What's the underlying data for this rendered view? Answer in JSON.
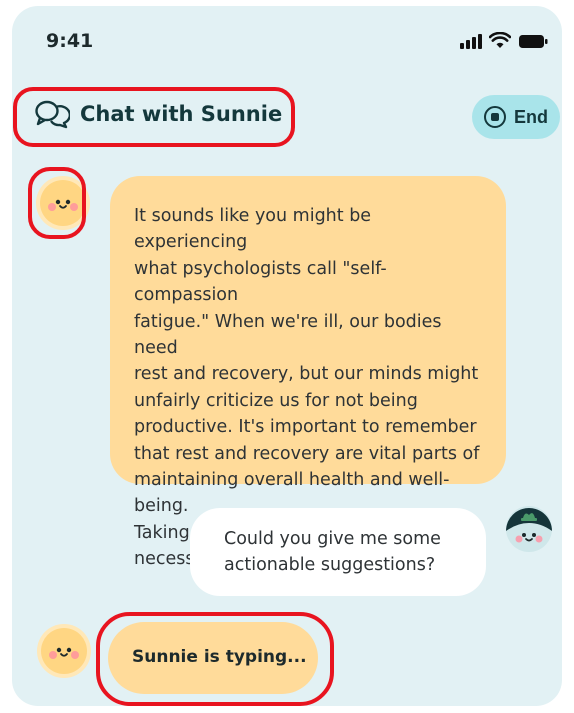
{
  "status_bar": {
    "time": "9:41",
    "icons": [
      "cellular-signal-icon",
      "wifi-icon",
      "battery-icon"
    ]
  },
  "header": {
    "title": "Chat with Sunnie",
    "icon": "chat-bubbles-icon",
    "end_button": {
      "label": "End",
      "icon": "stop-circle-icon"
    }
  },
  "messages": [
    {
      "sender": "Sunnie",
      "avatar": "sun-face-avatar",
      "lines": [
        "It sounds like you might be experiencing",
        "what psychologists call \"self-compassion",
        "fatigue.\" When we're ill, our bodies need",
        "rest and recovery, but our minds might",
        "unfairly criticize us for not being",
        "productive. It's important to remember",
        "that rest and recovery are vital parts of",
        "maintaining overall health and well-being.",
        "Taking time to heal isn't laziness; it's",
        "necessary self-care."
      ]
    },
    {
      "sender": "user",
      "avatar": "user-avatar",
      "lines": [
        "Could you give me some",
        "actionable suggestions?"
      ]
    }
  ],
  "typing_indicator": {
    "text": "Sunnie is typing..."
  },
  "colors": {
    "background": "#e2f1f4",
    "bot_bubble": "#ffdb9a",
    "user_bubble": "#ffffff",
    "end_button": "#a9e4ea",
    "title_text": "#14383c",
    "highlight": "#e8141f"
  }
}
